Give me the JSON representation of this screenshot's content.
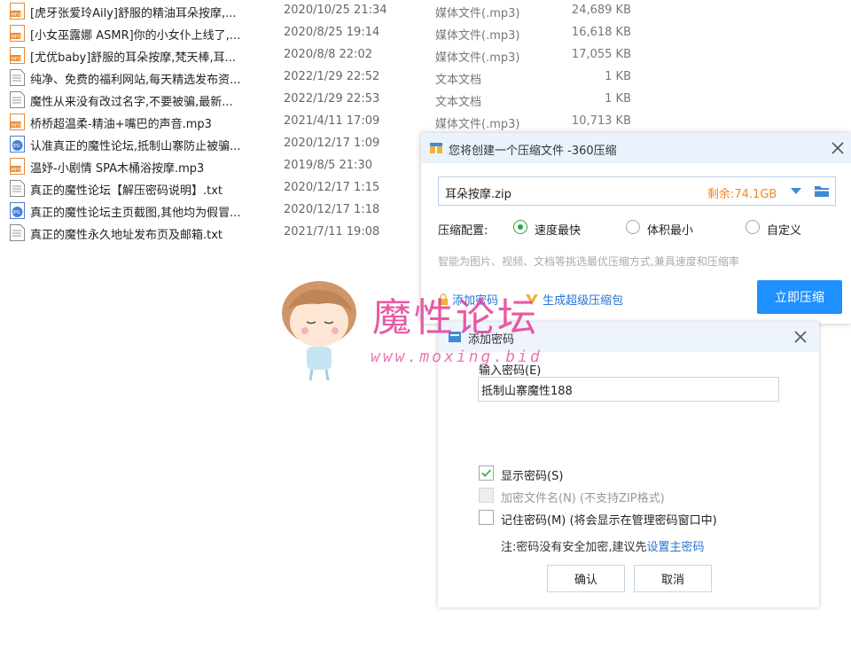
{
  "files": [
    {
      "icon": "mp3-icon",
      "name": "[虎牙张爱玲Aily]舒服的精油耳朵按摩,...",
      "date": "2020/10/25 21:34",
      "type": "媒体文件(.mp3)",
      "size": "24,689 KB"
    },
    {
      "icon": "mp3-icon",
      "name": "[小女巫露娜 ASMR]你的小女仆上线了,...",
      "date": "2020/8/25 19:14",
      "type": "媒体文件(.mp3)",
      "size": "16,618 KB"
    },
    {
      "icon": "mp3-icon",
      "name": "[尤优baby]舒服的耳朵按摩,梵天棒,耳...",
      "date": "2020/8/8 22:02",
      "type": "媒体文件(.mp3)",
      "size": "17,055 KB"
    },
    {
      "icon": "txt-icon",
      "name": "纯净、免费的福利网站,每天精选发布资...",
      "date": "2022/1/29 22:52",
      "type": "文本文档",
      "size": "1 KB"
    },
    {
      "icon": "txt-icon",
      "name": "魔性从来没有改过名字,不要被骗,最新...",
      "date": "2022/1/29 22:53",
      "type": "文本文档",
      "size": "1 KB"
    },
    {
      "icon": "mp3-icon",
      "name": "桥桥超温柔-精油+嘴巴的声音.mp3",
      "date": "2021/4/11 17:09",
      "type": "媒体文件(.mp3)",
      "size": "10,713 KB"
    },
    {
      "icon": "jpg-icon",
      "name": "认准真正的魔性论坛,抵制山寨防止被骗...",
      "date": "2020/12/17 1:09",
      "type": "",
      "size": ""
    },
    {
      "icon": "mp3-icon",
      "name": "温妤-小剧情 SPA木桶浴按摩.mp3",
      "date": "2019/8/5 21:30",
      "type": "",
      "size": ""
    },
    {
      "icon": "txt-icon",
      "name": "真正的魔性论坛【解压密码说明】.txt",
      "date": "2020/12/17 1:15",
      "type": "",
      "size": ""
    },
    {
      "icon": "jpg-icon",
      "name": "真正的魔性论坛主页截图,其他均为假冒...",
      "date": "2020/12/17 1:18",
      "type": "",
      "size": ""
    },
    {
      "icon": "txt-icon",
      "name": "真正的魔性永久地址发布页及邮箱.txt",
      "date": "2021/7/11 19:08",
      "type": "",
      "size": ""
    }
  ],
  "compress_dialog": {
    "title": "您将创建一个压缩文件 -360压缩",
    "filename": "耳朵按摩.zip",
    "free_space": "剩余:74.1GB",
    "config_label": "压缩配置:",
    "options": [
      {
        "label": "速度最快",
        "selected": true
      },
      {
        "label": "体积最小",
        "selected": false
      },
      {
        "label": "自定义",
        "selected": false
      }
    ],
    "hint": "智能为图片、视频、文档等挑选最优压缩方式,兼具速度和压缩率",
    "add_password": "添加密码",
    "super_package": "生成超级压缩包",
    "compress_button": "立即压缩"
  },
  "password_dialog": {
    "title": "添加密码",
    "input_label": "输入密码(E)",
    "password_value": "抵制山寨魔性188",
    "show_password": {
      "label": "显示密码(S)",
      "checked": true
    },
    "encrypt_filename": {
      "label": "加密文件名(N) (不支持ZIP格式)",
      "checked": false,
      "disabled": true
    },
    "remember_password": {
      "label": "记住密码(M) (将会显示在管理密码窗口中)",
      "checked": false
    },
    "note_prefix": "注:密码没有安全加密,建议先",
    "note_link": "设置主密码",
    "ok_button": "确认",
    "cancel_button": "取消"
  },
  "watermark": {
    "text": "魔性论坛",
    "url": "www.moxing.bid"
  },
  "colors": {
    "accent": "#1e90ff",
    "link": "#2874d6",
    "free_space": "#f08a24",
    "radio_selected": "#28a745",
    "watermark": "#e43c96"
  }
}
